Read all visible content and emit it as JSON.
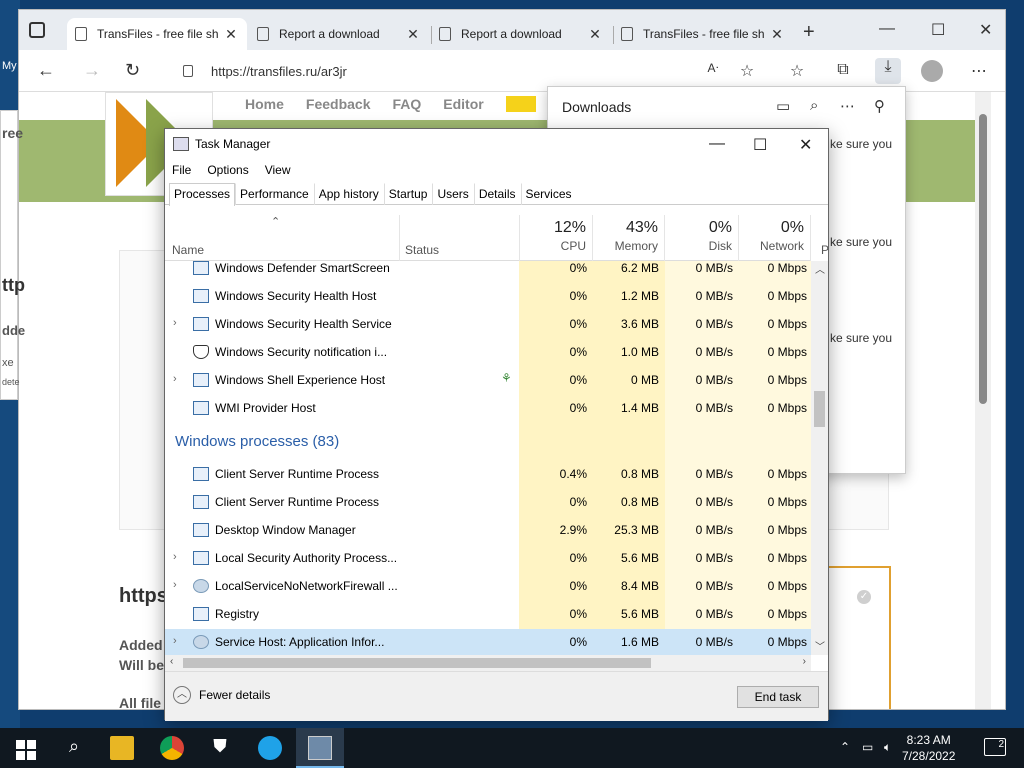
{
  "desktop": {
    "left_text": "My"
  },
  "browser": {
    "tabs": [
      {
        "label": "TransFiles - free file sh",
        "active": true
      },
      {
        "label": "Report a download",
        "active": false
      },
      {
        "label": "Report a download",
        "active": false
      },
      {
        "label": "TransFiles - free file sh",
        "active": false
      }
    ],
    "url": "https://transfiles.ru/ar3jr",
    "icons": [
      "back-icon",
      "forward-icon",
      "refresh-icon",
      "lock-icon",
      "read-aloud-icon",
      "add-favorite-icon",
      "favorites-icon",
      "collections-icon",
      "downloads-icon",
      "profile-icon",
      "more-icon"
    ]
  },
  "site": {
    "nav": [
      "Home",
      "Feedback",
      "FAQ",
      "Editor"
    ],
    "heading": "https",
    "added_line1": "Added",
    "added_line2": "Will be",
    "all_files": "All file",
    "left_fragments": [
      "ttp",
      "dde",
      "xe",
      "dete",
      "ree"
    ]
  },
  "downloads": {
    "title": "Downloads",
    "lines": [
      "ke sure you",
      "ke sure you",
      "ke sure you"
    ]
  },
  "taskmanager": {
    "title": "Task Manager",
    "menu": [
      "File",
      "Options",
      "View"
    ],
    "tabs": [
      "Processes",
      "Performance",
      "App history",
      "Startup",
      "Users",
      "Details",
      "Services"
    ],
    "active_tab": "Processes",
    "columns": {
      "name": "Name",
      "status": "Status",
      "cpu": {
        "pct": "12%",
        "label": "CPU"
      },
      "memory": {
        "pct": "43%",
        "label": "Memory"
      },
      "disk": {
        "pct": "0%",
        "label": "Disk"
      },
      "network": {
        "pct": "0%",
        "label": "Network"
      },
      "power_cut": "P"
    },
    "rows_top": [
      {
        "name": "Windows Defender SmartScreen",
        "cpu": "0%",
        "mem": "6.2 MB",
        "disk": "0 MB/s",
        "net": "0 Mbps",
        "expand": false,
        "icon": "window"
      },
      {
        "name": "Windows Security Health Host",
        "cpu": "0%",
        "mem": "1.2 MB",
        "disk": "0 MB/s",
        "net": "0 Mbps",
        "expand": false,
        "icon": "window"
      },
      {
        "name": "Windows Security Health Service",
        "cpu": "0%",
        "mem": "3.6 MB",
        "disk": "0 MB/s",
        "net": "0 Mbps",
        "expand": true,
        "icon": "window"
      },
      {
        "name": "Windows Security notification i...",
        "cpu": "0%",
        "mem": "1.0 MB",
        "disk": "0 MB/s",
        "net": "0 Mbps",
        "expand": false,
        "icon": "shield"
      },
      {
        "name": "Windows Shell Experience Host",
        "cpu": "0%",
        "mem": "0 MB",
        "disk": "0 MB/s",
        "net": "0 Mbps",
        "expand": true,
        "icon": "window",
        "leaf": true
      },
      {
        "name": "WMI Provider Host",
        "cpu": "0%",
        "mem": "1.4 MB",
        "disk": "0 MB/s",
        "net": "0 Mbps",
        "expand": false,
        "icon": "window"
      }
    ],
    "group": "Windows processes (83)",
    "rows_bottom": [
      {
        "name": "Client Server Runtime Process",
        "cpu": "0.4%",
        "mem": "0.8 MB",
        "disk": "0 MB/s",
        "net": "0 Mbps",
        "expand": false,
        "icon": "window"
      },
      {
        "name": "Client Server Runtime Process",
        "cpu": "0%",
        "mem": "0.8 MB",
        "disk": "0 MB/s",
        "net": "0 Mbps",
        "expand": false,
        "icon": "window"
      },
      {
        "name": "Desktop Window Manager",
        "cpu": "2.9%",
        "mem": "25.3 MB",
        "disk": "0 MB/s",
        "net": "0 Mbps",
        "expand": false,
        "icon": "window"
      },
      {
        "name": "Local Security Authority Process...",
        "cpu": "0%",
        "mem": "5.6 MB",
        "disk": "0 MB/s",
        "net": "0 Mbps",
        "expand": true,
        "icon": "window"
      },
      {
        "name": "LocalServiceNoNetworkFirewall ...",
        "cpu": "0%",
        "mem": "8.4 MB",
        "disk": "0 MB/s",
        "net": "0 Mbps",
        "expand": true,
        "icon": "gear"
      },
      {
        "name": "Registry",
        "cpu": "0%",
        "mem": "5.6 MB",
        "disk": "0 MB/s",
        "net": "0 Mbps",
        "expand": false,
        "icon": "window"
      },
      {
        "name": "Service Host: Application Infor...",
        "cpu": "0%",
        "mem": "1.6 MB",
        "disk": "0 MB/s",
        "net": "0 Mbps",
        "expand": true,
        "icon": "gear",
        "selected": true
      }
    ],
    "fewer_details": "Fewer details",
    "end_task": "End task"
  },
  "taskbar": {
    "time": "8:23 AM",
    "date": "7/28/2022",
    "notifications": "2"
  }
}
